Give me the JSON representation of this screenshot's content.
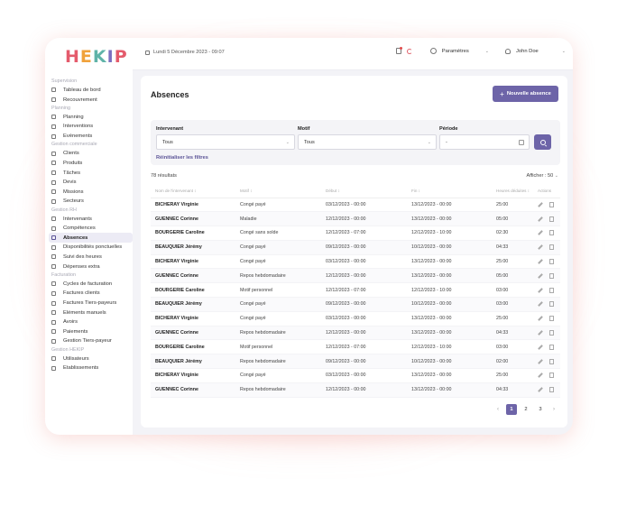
{
  "app": {
    "logo_text": "HEKIP"
  },
  "sidebar": {
    "sections": [
      {
        "title": "Supervision",
        "items": [
          {
            "label": "Tableau de bord",
            "icon": "home-icon"
          },
          {
            "label": "Recouvrement",
            "icon": "refresh-icon"
          }
        ]
      },
      {
        "title": "Planning",
        "items": [
          {
            "label": "Planning",
            "icon": "calendar-icon"
          },
          {
            "label": "Interventions",
            "icon": "heart-icon"
          },
          {
            "label": "Evénements",
            "icon": "calendar-icon"
          }
        ]
      },
      {
        "title": "Gestion commerciale",
        "items": [
          {
            "label": "Clients",
            "icon": "user-icon"
          },
          {
            "label": "Produits",
            "icon": "cart-icon"
          },
          {
            "label": "Tâches",
            "icon": "checkbox-icon"
          },
          {
            "label": "Devis",
            "icon": "document-icon"
          },
          {
            "label": "Missions",
            "icon": "folder-icon"
          },
          {
            "label": "Secteurs",
            "icon": "location-icon"
          }
        ]
      },
      {
        "title": "Gestion RH",
        "items": [
          {
            "label": "Intervenants",
            "icon": "user-icon"
          },
          {
            "label": "Compétences",
            "icon": "badge-icon"
          },
          {
            "label": "Absences",
            "icon": "absence-icon",
            "active": true
          },
          {
            "label": "Disponibilités ponctuelles",
            "icon": "user-clock-icon"
          },
          {
            "label": "Suivi des heures",
            "icon": "clock-icon"
          },
          {
            "label": "Dépenses extra",
            "icon": "receipt-icon"
          }
        ]
      },
      {
        "title": "Facturation",
        "items": [
          {
            "label": "Cycles de facturation",
            "icon": "cycle-icon"
          },
          {
            "label": "Factures clients",
            "icon": "paperclip-icon"
          },
          {
            "label": "Factures Tiers-payeurs",
            "icon": "paperclip-icon"
          },
          {
            "label": "Eléments manuels",
            "icon": "edit-icon"
          },
          {
            "label": "Avoirs",
            "icon": "return-icon"
          },
          {
            "label": "Paiements",
            "icon": "euro-icon"
          },
          {
            "label": "Gestion Tiers-payeur",
            "icon": "transfer-icon"
          }
        ]
      },
      {
        "title": "Gestion HEKIP",
        "items": [
          {
            "label": "Utilisateurs",
            "icon": "lock-icon"
          },
          {
            "label": "Etablissements",
            "icon": "grid-icon"
          }
        ]
      }
    ]
  },
  "topbar": {
    "date": "Lundi 5 Décembre 2023 - 09:07",
    "settings_label": "Paramètres",
    "user_name": "John Doe"
  },
  "page": {
    "title": "Absences",
    "new_button": "Nouvelle absence"
  },
  "filters": {
    "intervenant_label": "Intervenant",
    "intervenant_value": "Tous",
    "motif_label": "Motif",
    "motif_value": "Tous",
    "periode_label": "Période",
    "periode_value": "-",
    "reset_label": "Réinitialiser les filtres"
  },
  "list": {
    "results": "78 résultats",
    "per_page": "Afficher : 50",
    "headers": [
      "Nom de l'intervenant ↕",
      "Motif ↕",
      "Début ↕",
      "Fin ↕",
      "Heures déduites ↕",
      "Actions"
    ],
    "rows": [
      [
        "BICHERAY Virginie",
        "Congé payé",
        "03/12/2023 - 00:00",
        "13/12/2023 - 00:00",
        "25:00"
      ],
      [
        "GUENNEC Corinne",
        "Maladie",
        "12/12/2023 - 00:00",
        "13/12/2023 - 00:00",
        "05:00"
      ],
      [
        "BOURGERIE Caroline",
        "Congé sans solde",
        "12/12/2023 - 07:00",
        "12/12/2023 - 10:00",
        "02:30"
      ],
      [
        "BEAUQUIER Jérémy",
        "Congé payé",
        "09/12/2023 - 00:00",
        "10/12/2023 - 00:00",
        "04:33"
      ],
      [
        "BICHERAY Virginie",
        "Congé payé",
        "03/12/2023 - 00:00",
        "13/12/2023 - 00:00",
        "25:00"
      ],
      [
        "GUENNEC Corinne",
        "Repos hebdomadaire",
        "12/12/2023 - 00:00",
        "13/12/2023 - 00:00",
        "05:00"
      ],
      [
        "BOURGERIE Caroline",
        "Motif personnel",
        "12/12/2023 - 07:00",
        "12/12/2023 - 10:00",
        "03:00"
      ],
      [
        "BEAUQUIER Jérémy",
        "Congé payé",
        "09/12/2023 - 00:00",
        "10/12/2023 - 00:00",
        "03:00"
      ],
      [
        "BICHERAY Virginie",
        "Congé payé",
        "03/12/2023 - 00:00",
        "13/12/2023 - 00:00",
        "25:00"
      ],
      [
        "GUENNEC Corinne",
        "Repos hebdomadaire",
        "12/12/2023 - 00:00",
        "13/12/2023 - 00:00",
        "04:33"
      ],
      [
        "BOURGERIE Caroline",
        "Motif personnel",
        "12/12/2023 - 07:00",
        "12/12/2023 - 10:00",
        "03:00"
      ],
      [
        "BEAUQUIER Jérémy",
        "Repos hebdomadaire",
        "09/12/2023 - 00:00",
        "10/12/2023 - 00:00",
        "02:00"
      ],
      [
        "BICHERAY Virginie",
        "Congé payé",
        "03/12/2023 - 00:00",
        "13/12/2023 - 00:00",
        "25:00"
      ],
      [
        "GUENNEC Corinne",
        "Repos hebdomadaire",
        "12/12/2023 - 00:00",
        "13/12/2023 - 00:00",
        "04:33"
      ]
    ]
  },
  "pagination": {
    "prev": "‹",
    "pages": [
      "1",
      "2",
      "3"
    ],
    "current": "1",
    "next": "›"
  },
  "colors": {
    "accent": "#6d64a8",
    "logo": [
      "#e45b6c",
      "#f0a23b",
      "#5fb3a8",
      "#7a6fc0",
      "#e45b6c"
    ]
  }
}
